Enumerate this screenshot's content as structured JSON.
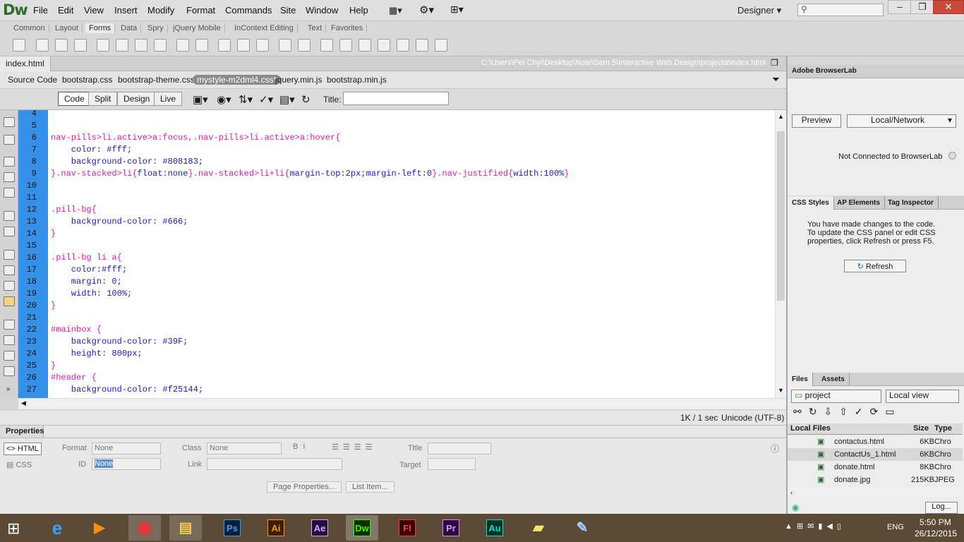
{
  "app": {
    "logo": "Dw",
    "menus": [
      "File",
      "Edit",
      "View",
      "Insert",
      "Modify",
      "Format",
      "Commands",
      "Site",
      "Window",
      "Help"
    ],
    "workspace": "Designer"
  },
  "insert": {
    "tabs": [
      "Common",
      "Layout",
      "Forms",
      "Data",
      "Spry",
      "jQuery Mobile",
      "InContext Editing",
      "Text",
      "Favorites"
    ]
  },
  "document": {
    "tab": "index.html",
    "path": "C:\\Users\\Pei Chyi\\Desktop\\Note\\Sem 5\\Interactive Web Design\\projecta\\index.html",
    "related": [
      "Source Code",
      "bootstrap.css",
      "bootstrap-theme.css",
      "mystyle-m2dml4.css*",
      "jquery.min.js",
      "bootstrap.min.js"
    ],
    "views": [
      "Code",
      "Split",
      "Design",
      "Live"
    ],
    "title_label": "Title:"
  },
  "code": {
    "lines": [
      {
        "n": "4",
        "parts": []
      },
      {
        "n": "5",
        "parts": []
      },
      {
        "n": "6",
        "parts": [
          {
            "c": "pink",
            "t": "nav-pills>li.active>a:focus,.nav-pills>li.active>a:hover{"
          }
        ]
      },
      {
        "n": "7",
        "parts": [
          {
            "c": "navy",
            "t": "    color: #fff;"
          }
        ]
      },
      {
        "n": "8",
        "parts": [
          {
            "c": "navy",
            "t": "    background-color: #808183;"
          }
        ]
      },
      {
        "n": "9",
        "parts": [
          {
            "c": "pink",
            "t": "}.nav-stacked>li{"
          },
          {
            "c": "navy",
            "t": "float:none"
          },
          {
            "c": "pink",
            "t": "}.nav-stacked>li+li{"
          },
          {
            "c": "navy",
            "t": "margin-top:2px;margin-left:0"
          },
          {
            "c": "pink",
            "t": "}.nav-justified{"
          },
          {
            "c": "navy",
            "t": "width:100%"
          },
          {
            "c": "pink",
            "t": "}"
          }
        ]
      },
      {
        "n": "10",
        "parts": []
      },
      {
        "n": "11",
        "parts": []
      },
      {
        "n": "12",
        "parts": [
          {
            "c": "pink",
            "t": ".pill-bg{"
          }
        ]
      },
      {
        "n": "13",
        "parts": [
          {
            "c": "navy",
            "t": "    background-color: #666;"
          }
        ]
      },
      {
        "n": "14",
        "parts": [
          {
            "c": "pink",
            "t": "}"
          }
        ]
      },
      {
        "n": "15",
        "parts": []
      },
      {
        "n": "16",
        "parts": [
          {
            "c": "pink",
            "t": ".pill-bg li a{"
          }
        ]
      },
      {
        "n": "17",
        "parts": [
          {
            "c": "navy",
            "t": "    color:#fff;"
          }
        ]
      },
      {
        "n": "18",
        "parts": [
          {
            "c": "navy",
            "t": "    margin: 0;"
          }
        ]
      },
      {
        "n": "19",
        "parts": [
          {
            "c": "navy",
            "t": "    width: 100%;"
          }
        ]
      },
      {
        "n": "20",
        "parts": [
          {
            "c": "pink",
            "t": "}"
          }
        ]
      },
      {
        "n": "21",
        "parts": []
      },
      {
        "n": "22",
        "parts": [
          {
            "c": "pink",
            "t": "#mainbox {"
          }
        ]
      },
      {
        "n": "23",
        "parts": [
          {
            "c": "navy",
            "t": "    background-color: #39F;"
          }
        ]
      },
      {
        "n": "24",
        "parts": [
          {
            "c": "navy",
            "t": "    height: 800px;"
          }
        ]
      },
      {
        "n": "25",
        "parts": [
          {
            "c": "pink",
            "t": "}"
          }
        ]
      },
      {
        "n": "26",
        "parts": [
          {
            "c": "pink",
            "t": "#header {"
          }
        ]
      },
      {
        "n": "27",
        "parts": [
          {
            "c": "navy",
            "t": "    background-color: #f25144;"
          }
        ]
      }
    ]
  },
  "status": {
    "download": "1K / 1 sec",
    "encoding": "Unicode (UTF-8)"
  },
  "properties": {
    "header": "Properties",
    "html": "HTML",
    "css": "CSS",
    "format_label": "Format",
    "format_value": "None",
    "class_label": "Class",
    "class_value": "None",
    "id_label": "ID",
    "id_value": "None",
    "link_label": "Link",
    "title_label": "Title",
    "target_label": "Target",
    "page_props": "Page Properties...",
    "list_item": "List Item..."
  },
  "browserlab": {
    "header": "Adobe BrowserLab",
    "preview": "Preview",
    "mode": "Local/Network",
    "status": "Not Connected to BrowserLab"
  },
  "csspanel": {
    "tabs": [
      "CSS Styles",
      "AP Elements",
      "Tag Inspector"
    ],
    "message": "You have made changes to the code.\nTo update the CSS panel or edit CSS\nproperties, click Refresh or press F5.",
    "refresh": "Refresh"
  },
  "files": {
    "tabs": [
      "Files",
      "Assets"
    ],
    "site": "project",
    "view": "Local view",
    "cols": [
      "Local Files",
      "Size",
      "Type"
    ],
    "rows": [
      {
        "name": "contactus.html",
        "size": "6KB",
        "type": "Chro"
      },
      {
        "name": "ContactUs_1.html",
        "size": "6KB",
        "type": "Chro"
      },
      {
        "name": "donate.html",
        "size": "8KB",
        "type": "Chro"
      },
      {
        "name": "donate.jpg",
        "size": "215KB",
        "type": "JPEG"
      }
    ],
    "log": "Log..."
  },
  "taskbar": {
    "apps": [
      {
        "k": "Ps",
        "fg": "#2fa3f7",
        "bg": "#0b1b3a"
      },
      {
        "k": "Ai",
        "fg": "#ff9a00",
        "bg": "#3a1f00"
      },
      {
        "k": "Ae",
        "fg": "#d8a3ff",
        "bg": "#200f3c"
      },
      {
        "k": "Dw",
        "fg": "#35fa00",
        "bg": "#0b2a00"
      },
      {
        "k": "Fl",
        "fg": "#ff3b30",
        "bg": "#3a0000"
      },
      {
        "k": "Pr",
        "fg": "#e58bff",
        "bg": "#2a0a3a"
      },
      {
        "k": "Au",
        "fg": "#00e4bb",
        "bg": "#00302a"
      }
    ],
    "lang": "ENG",
    "time": "5:50 PM",
    "date": "26/12/2015"
  }
}
